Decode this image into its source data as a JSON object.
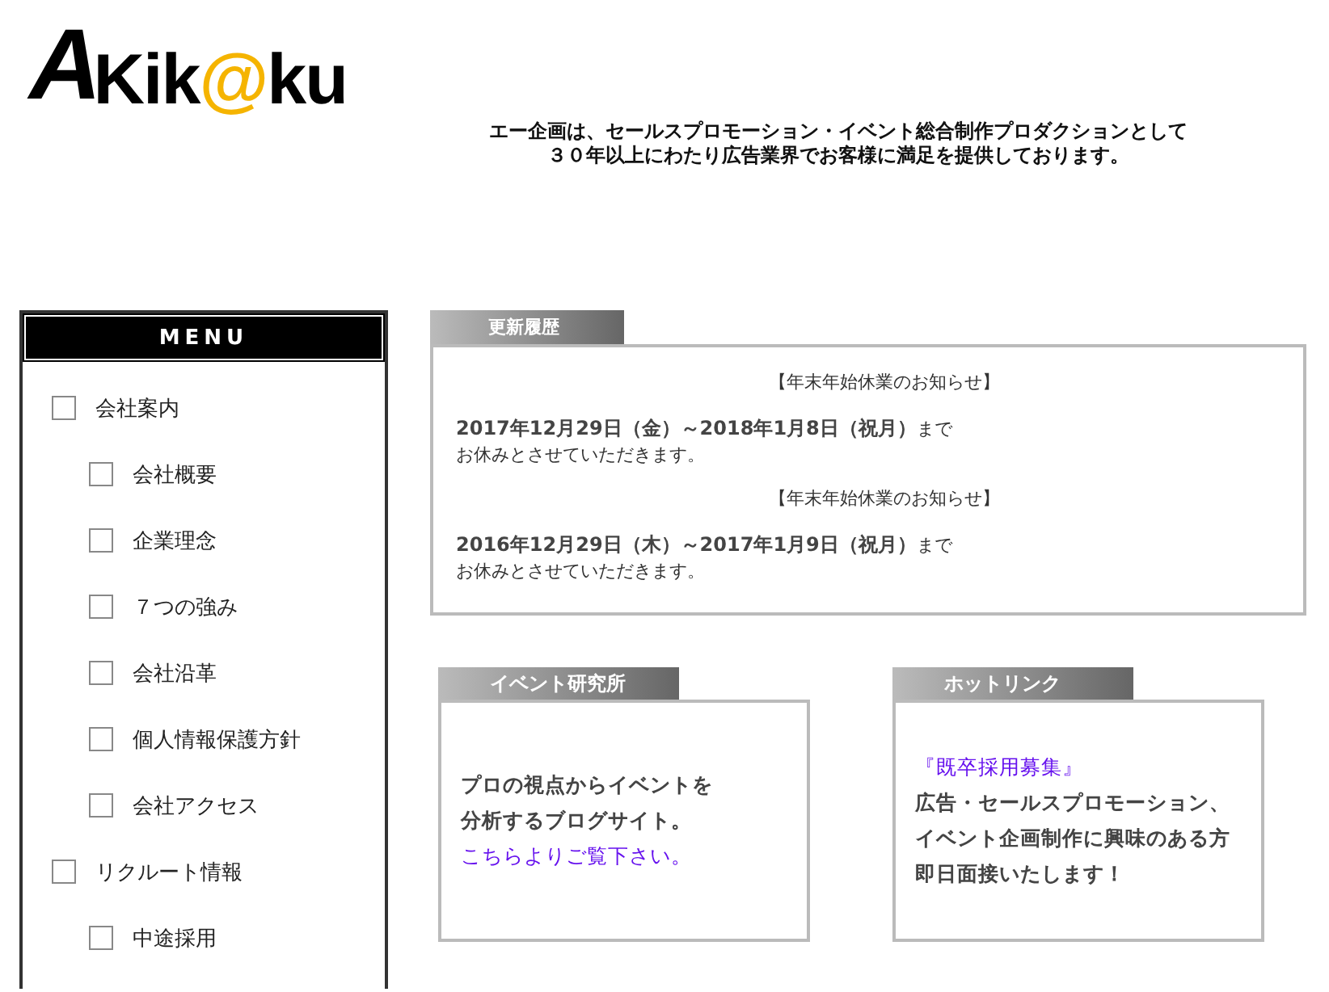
{
  "logo": {
    "parts": [
      {
        "text": "A",
        "color": "#000000"
      },
      {
        "text": "Kik",
        "color": "#000000"
      },
      {
        "text": "@",
        "color": "#f5b400"
      },
      {
        "text": "ku",
        "color": "#000000"
      }
    ]
  },
  "tagline": [
    "エー企画は、セールスプロモーション・イベント総合制作プロダクションとして",
    "３０年以上にわたり広告業界でお客様に満足を提供しております。"
  ],
  "menu": {
    "title": "MENU",
    "items": [
      {
        "label": "会社案内",
        "checked": false,
        "children": [
          {
            "label": "会社概要",
            "checked": false
          },
          {
            "label": "企業理念",
            "checked": false
          },
          {
            "label": "７つの強み",
            "checked": false
          },
          {
            "label": "会社沿革",
            "checked": false
          },
          {
            "label": "個人情報保護方針",
            "checked": false
          },
          {
            "label": "会社アクセス",
            "checked": false
          }
        ]
      },
      {
        "label": "リクルート情報",
        "checked": false,
        "children": [
          {
            "label": "中途採用",
            "checked": false
          }
        ]
      }
    ]
  },
  "news": {
    "title": "更新履歴",
    "entries": [
      {
        "heading": "【年末年始休業のお知らせ】",
        "dates": "2017年12月29日（金）～2018年1月8日（祝月）",
        "suffix": "まで",
        "note": "お休みとさせていただきます。"
      },
      {
        "heading": "【年末年始休業のお知らせ】",
        "dates": "2016年12月29日（木）～2017年1月9日（祝月）",
        "suffix": "まで",
        "note": "お休みとさせていただきます。"
      }
    ]
  },
  "event_lab": {
    "title": "イベント研究所",
    "lines": [
      {
        "kind": "text",
        "text": "プロの視点からイベントを"
      },
      {
        "kind": "text",
        "text": "分析するブログサイト。"
      },
      {
        "kind": "link",
        "text": "こちらよりご覧下さい。"
      }
    ]
  },
  "hot_link": {
    "title": "ホットリンク",
    "lines": [
      {
        "kind": "link",
        "text": "『既卒採用募集』"
      },
      {
        "kind": "text",
        "text": "広告・セールスプロモーション、"
      },
      {
        "kind": "text",
        "text": "イベント企画制作に興味のある方"
      },
      {
        "kind": "text",
        "text": "即日面接いたします！"
      }
    ]
  }
}
